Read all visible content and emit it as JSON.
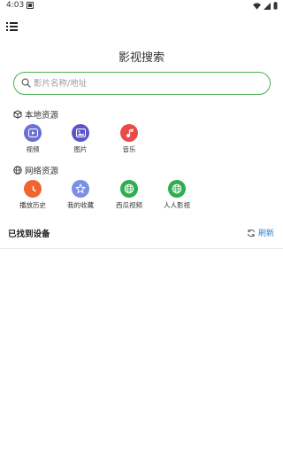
{
  "status_bar": {
    "time": "4:03"
  },
  "header": {
    "menu_icon": "menu-list-icon",
    "title": "影视搜索"
  },
  "search": {
    "placeholder": "影片名称/地址",
    "icon": "search-icon"
  },
  "local_section": {
    "title": "本地资源",
    "icon": "box-icon",
    "items": [
      {
        "label": "视频",
        "icon": "video-play-icon",
        "color": "#6b6fd6"
      },
      {
        "label": "图片",
        "icon": "image-icon",
        "color": "#5b56c8"
      },
      {
        "label": "音乐",
        "icon": "music-note-icon",
        "color": "#e94c48"
      }
    ]
  },
  "network_section": {
    "title": "网络资源",
    "icon": "globe-icon",
    "items": [
      {
        "label": "播放历史",
        "icon": "clock-icon",
        "color": "#f0642f"
      },
      {
        "label": "我的收藏",
        "icon": "star-icon",
        "color": "#7b8fe4"
      },
      {
        "label": "西瓜视频",
        "icon": "globe-icon",
        "color": "#2eae4f"
      },
      {
        "label": "人人影视",
        "icon": "globe-icon",
        "color": "#2eae4f"
      }
    ]
  },
  "devices": {
    "title": "已找到设备",
    "refresh_label": "刷新",
    "refresh_icon": "refresh-icon"
  },
  "colors": {
    "accent_green": "#4caf50",
    "link_blue": "#2d7fd1"
  }
}
